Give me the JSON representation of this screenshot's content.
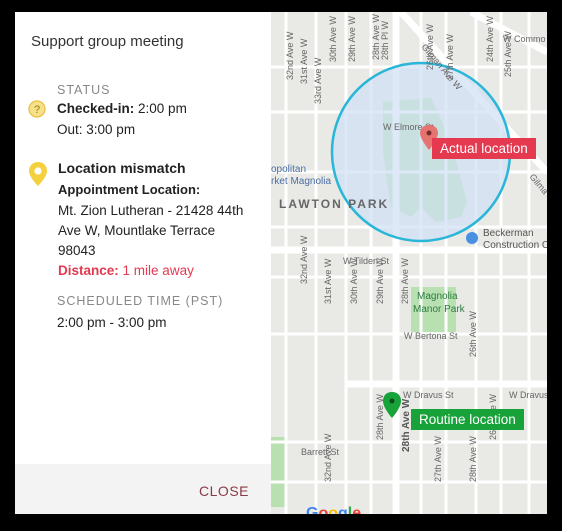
{
  "dialog": {
    "title": "Support group meeting",
    "close_label": "CLOSE"
  },
  "status": {
    "label": "STATUS",
    "checked_in_label": "Checked-in:",
    "checked_in_time": "2:00 pm",
    "out_label": "Out:",
    "out_time": "3:00 pm",
    "icon": "question-circle-icon",
    "icon_color": "#f4d03f"
  },
  "location": {
    "title": "Location mismatch",
    "icon": "map-pin-icon",
    "icon_color": "#f4d03f",
    "appointment_label": "Appointment Location:",
    "address_line1": "Mt. Zion Lutheran - 21428 44th",
    "address_line2": "Ave W, Mountlake Terrace",
    "address_line3": "98043",
    "distance_label": "Distance:",
    "distance_value": "1 mile away"
  },
  "schedule": {
    "label": "SCHEDULED TIME (PST)",
    "time": "2:00 pm - 3:00 pm"
  },
  "map": {
    "actual_label": "Actual location",
    "routine_label": "Routine location",
    "park_name": "LAWTON PARK",
    "magnolia_manor_1": "Magnolia",
    "magnolia_manor_2": "Manor Park",
    "beckerman_1": "Beckerman",
    "beckerman_2": "Construction Co",
    "metropolitan_1": "opolitan",
    "metropolitan_2": "rket Magnolia",
    "streets": {
      "w_elmore": "W Elmore St",
      "w_tilden": "W Tilden St",
      "w_dravus": "W Dravus St",
      "w_dravus_2": "W Dravus St",
      "barrett": "Barrett St",
      "w_bertona": "W Bertona St",
      "gilman": "Gilman Ave W",
      "w_commodore": "W Commo",
      "gilma_2": "Gilma",
      "ave32": "32nd Ave W",
      "ave31": "31st Ave W",
      "ave30": "30th Ave W",
      "ave29": "29th Ave W",
      "ave28": "28th Ave W",
      "ave28pl": "28th Pl W",
      "ave26": "26th Ave W",
      "ave27": "27th Ave W",
      "ave24": "24th Ave W",
      "ave25": "25th Ave W",
      "ave31b": "31st Ave W",
      "ave30b": "30th Ave W",
      "ave29b": "29th Ave W",
      "ave28b": "28th Ave W",
      "ave26b": "26th Ave W",
      "ave28c": "28th Ave W",
      "ave26c": "26th Ave W",
      "ave32b": "32nd Ave W",
      "ave33": "33rd Ave W",
      "ave32c": "32nd Ave W",
      "ave28d": "28th Ave W",
      "ave27b": "27th Ave W"
    },
    "colors": {
      "radius_fill": "#cfe0f4",
      "radius_stroke": "#29b6d8",
      "park_green": "#b9e0b1",
      "actual_pin": "#e5736f",
      "routine_pin": "#17a23a"
    }
  },
  "google": {
    "letters": [
      "G",
      "o",
      "o",
      "g",
      "l",
      "e"
    ]
  }
}
